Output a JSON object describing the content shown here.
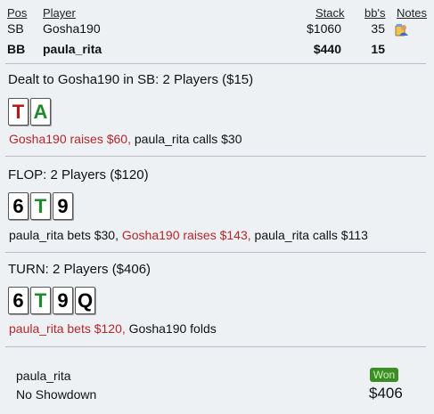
{
  "header": {
    "pos_label": "Pos",
    "player_label": "Player",
    "stack_label": "Stack",
    "bbs_label": "bb's",
    "notes_label": "Notes"
  },
  "players": [
    {
      "pos": "SB",
      "name": "Gosha190",
      "stack": "$1060",
      "bbs": "35",
      "bold": false,
      "note_icon": "user-note-icon"
    },
    {
      "pos": "BB",
      "name": "paula_rita",
      "stack": "$440",
      "bbs": "15",
      "bold": true,
      "note_icon": null
    }
  ],
  "preflop": {
    "title": "Dealt to Gosha190 in SB: 2 Players ($15)",
    "cards": [
      {
        "rank": "T",
        "color": "red"
      },
      {
        "rank": "A",
        "color": "green"
      }
    ],
    "actions": [
      {
        "text": "Gosha190 raises $60,",
        "highlight": true
      },
      {
        "text": "paula_rita calls $30",
        "highlight": false
      }
    ]
  },
  "flop": {
    "title": "FLOP: 2 Players ($120)",
    "cards": [
      {
        "rank": "6",
        "color": "black"
      },
      {
        "rank": "T",
        "color": "green"
      },
      {
        "rank": "9",
        "color": "black"
      }
    ],
    "actions": [
      {
        "text": "paula_rita bets $30,",
        "highlight": false
      },
      {
        "text": "Gosha190 raises $143,",
        "highlight": true
      },
      {
        "text": "paula_rita calls $113",
        "highlight": false
      }
    ]
  },
  "turn": {
    "title": "TURN: 2 Players ($406)",
    "cards": [
      {
        "rank": "6",
        "color": "black"
      },
      {
        "rank": "T",
        "color": "green"
      },
      {
        "rank": "9",
        "color": "black"
      },
      {
        "rank": "Q",
        "color": "black"
      }
    ],
    "actions": [
      {
        "text": "paula_rita bets $120,",
        "highlight": true
      },
      {
        "text": "Gosha190 folds",
        "highlight": false
      }
    ]
  },
  "result": {
    "winner": "paula_rita",
    "showdown": "No Showdown",
    "badge": "Won",
    "amount": "$406"
  },
  "colors": {
    "background": "#eef1f4",
    "action_highlight": "#b5262a",
    "won_badge": "#3c8d23",
    "card_red": "#b51a1a",
    "card_green": "#1f8a2c",
    "card_black": "#000000"
  }
}
